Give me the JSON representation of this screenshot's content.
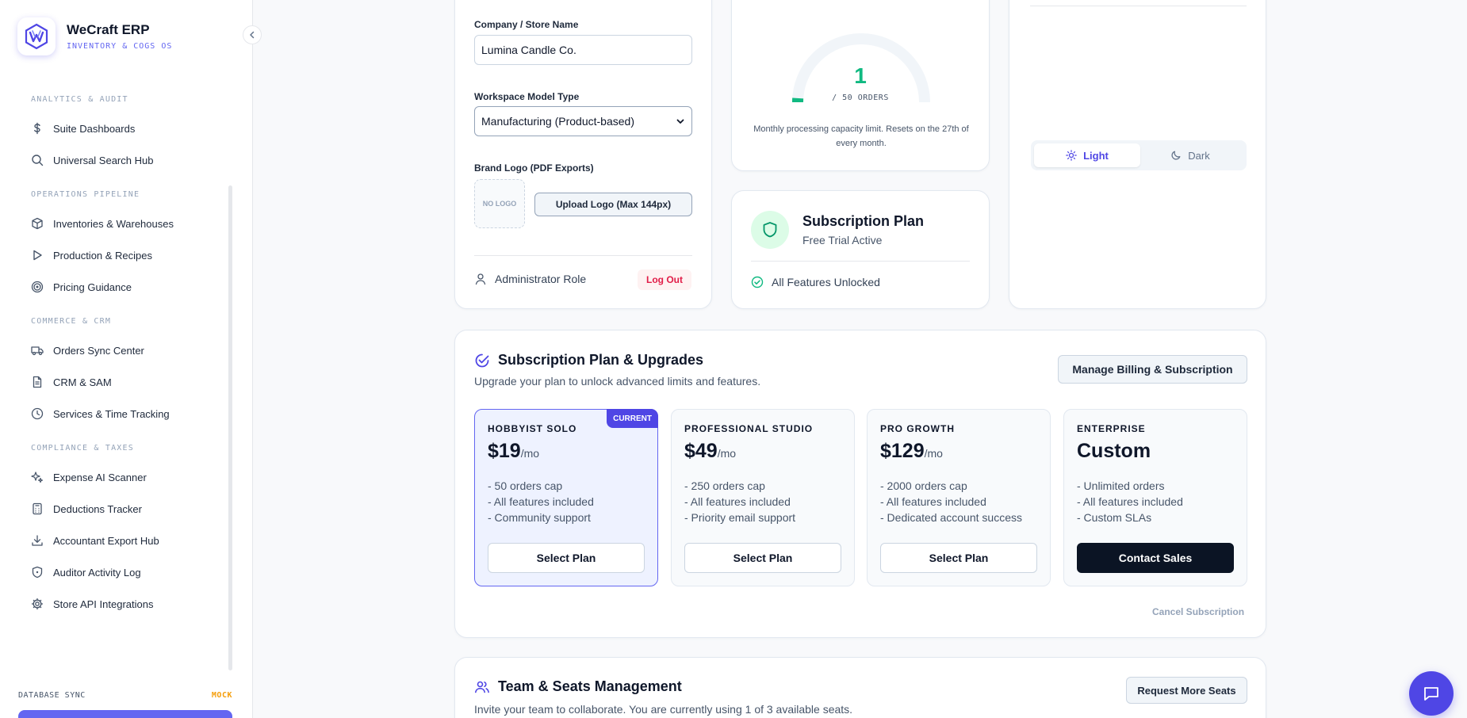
{
  "brand": {
    "title": "WeCraft ERP",
    "subtitle": "INVENTORY & COGS OS"
  },
  "sidebar": {
    "sections": [
      {
        "title": "ANALYTICS & AUDIT",
        "items": [
          {
            "label": "Suite Dashboards",
            "icon": "dollar-icon"
          },
          {
            "label": "Universal Search Hub",
            "icon": "search-icon"
          }
        ]
      },
      {
        "title": "OPERATIONS PIPELINE",
        "items": [
          {
            "label": "Inventories & Warehouses",
            "icon": "box-icon"
          },
          {
            "label": "Production & Recipes",
            "icon": "play-icon"
          },
          {
            "label": "Pricing Guidance",
            "icon": "target-icon"
          }
        ]
      },
      {
        "title": "COMMERCE & CRM",
        "items": [
          {
            "label": "Orders Sync Center",
            "icon": "truck-icon"
          },
          {
            "label": "CRM & SAM",
            "icon": "document-icon"
          },
          {
            "label": "Services & Time Tracking",
            "icon": "clock-icon"
          }
        ]
      },
      {
        "title": "COMPLIANCE & TAXES",
        "items": [
          {
            "label": "Expense AI Scanner",
            "icon": "sparkle-icon"
          },
          {
            "label": "Deductions Tracker",
            "icon": "calculator-icon"
          },
          {
            "label": "Accountant Export Hub",
            "icon": "download-icon"
          },
          {
            "label": "Auditor Activity Log",
            "icon": "shield-icon"
          },
          {
            "label": "Store API Integrations",
            "icon": "gear-icon"
          }
        ]
      }
    ],
    "db_sync": {
      "label": "DATABASE SYNC",
      "badge": "MOCK"
    }
  },
  "profile": {
    "company_label": "Company / Store Name",
    "company_value": "Lumina Candle Co.",
    "model_label": "Workspace Model Type",
    "model_value": "Manufacturing (Product-based)",
    "logo_label": "Brand Logo (PDF Exports)",
    "no_logo": "NO LOGO",
    "upload_button": "Upload Logo (Max 144px)",
    "role": "Administrator Role",
    "logout": "Log Out"
  },
  "usage": {
    "value": "1",
    "unit": "/ 50 ORDERS",
    "used": 1,
    "limit": 50,
    "note": "Monthly processing capacity limit. Resets on the 27th of every month."
  },
  "subscription": {
    "title": "Subscription Plan",
    "status": "Free Trial Active",
    "features": "All Features Unlocked"
  },
  "theme": {
    "light": "Light",
    "dark": "Dark",
    "selected": "Light"
  },
  "plans_section": {
    "title": "Subscription Plan & Upgrades",
    "description": "Upgrade your plan to unlock advanced limits and features.",
    "manage_button": "Manage Billing & Subscription",
    "current_badge": "CURRENT",
    "cancel": "Cancel Subscription",
    "plans": [
      {
        "name": "HOBBYIST SOLO",
        "price": "$19",
        "period": "/mo",
        "features": [
          "- 50 orders cap",
          "- All features included",
          "- Community support"
        ],
        "button": "Select Plan"
      },
      {
        "name": "PROFESSIONAL STUDIO",
        "price": "$49",
        "period": "/mo",
        "features": [
          "- 250 orders cap",
          "- All features included",
          "- Priority email support"
        ],
        "button": "Select Plan"
      },
      {
        "name": "PRO GROWTH",
        "price": "$129",
        "period": "/mo",
        "features": [
          "- 2000 orders cap",
          "- All features included",
          "- Dedicated account success"
        ],
        "button": "Select Plan"
      },
      {
        "name": "ENTERPRISE",
        "price": "Custom",
        "period": "",
        "features": [
          "- Unlimited orders",
          "- All features included",
          "- Custom SLAs"
        ],
        "button": "Contact Sales"
      }
    ]
  },
  "team": {
    "title": "Team & Seats Management",
    "description": "Invite your team to collaborate. You are currently using 1 of 3 available seats.",
    "request_button": "Request More Seats"
  },
  "colors": {
    "accent": "#4f46e5",
    "success": "#10b981",
    "danger": "#e11d48",
    "warning": "#f59e0b"
  }
}
